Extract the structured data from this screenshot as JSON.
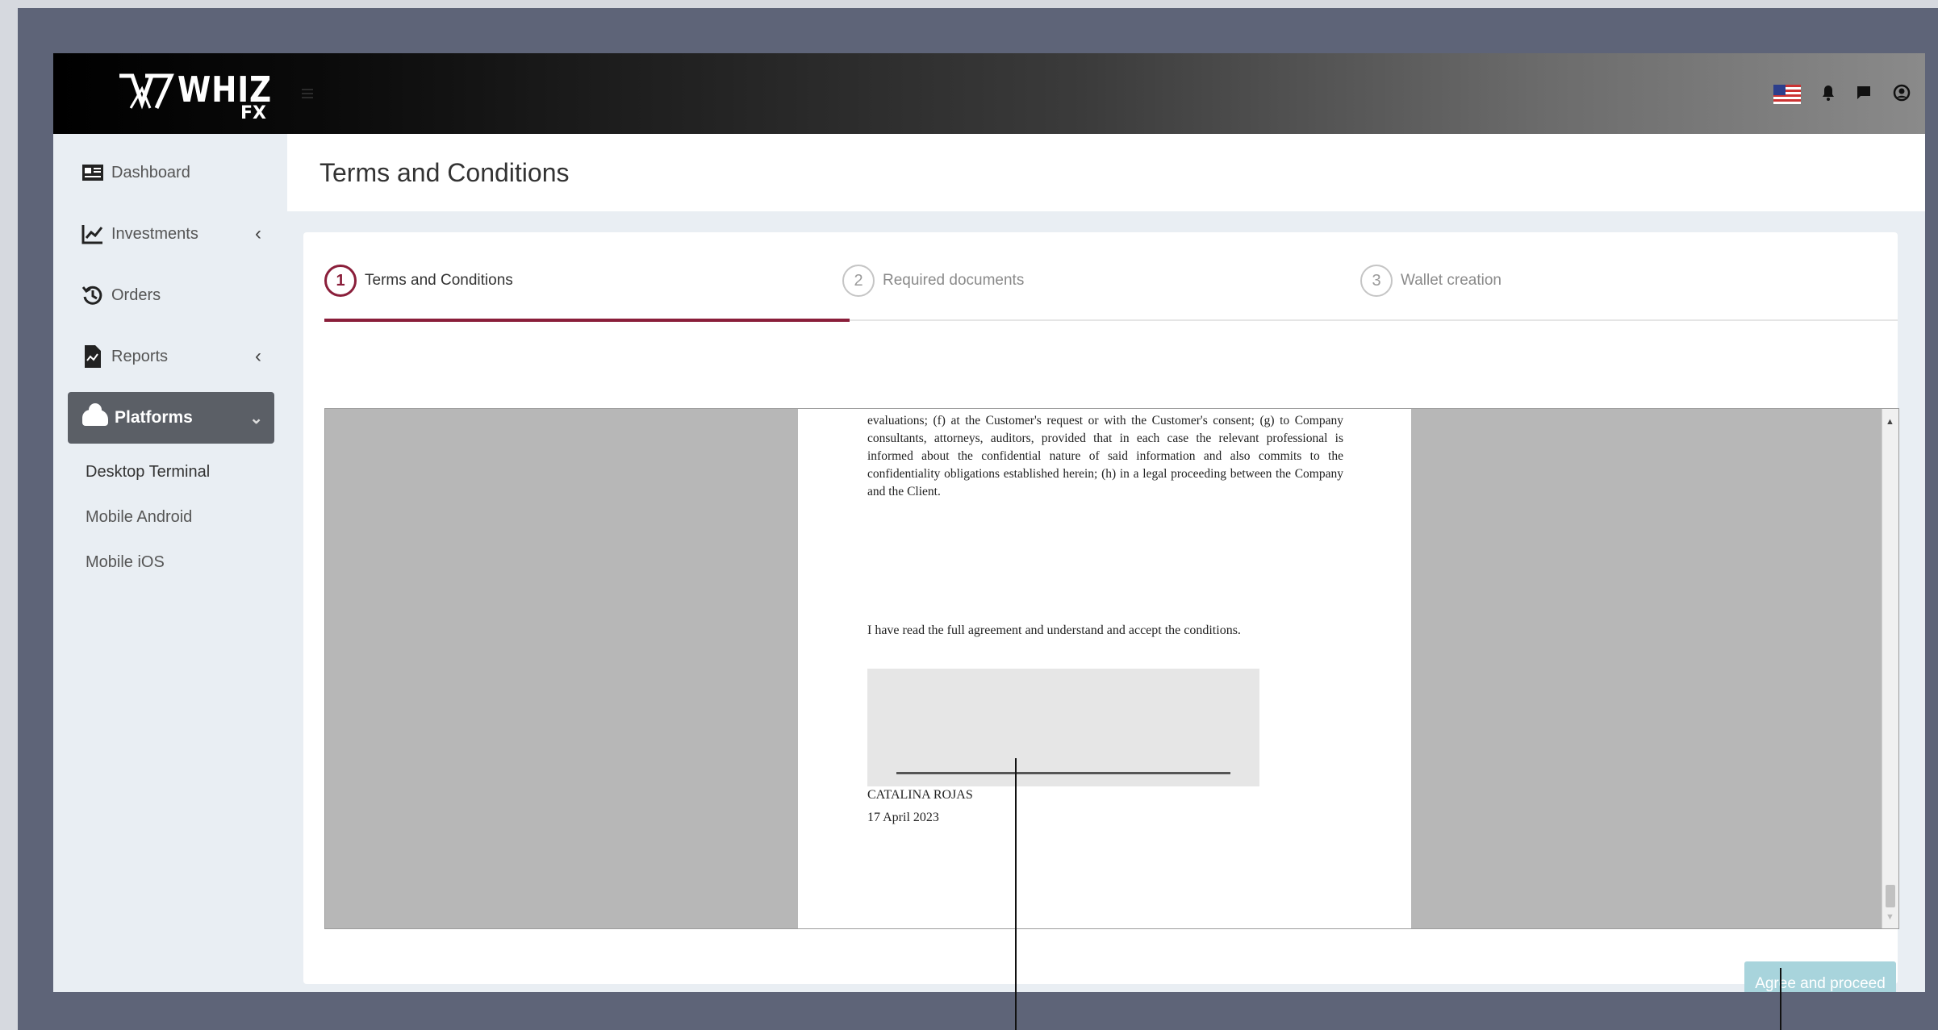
{
  "header": {
    "logo_text": "WHIZ",
    "logo_subtext": "FX",
    "icons": [
      "us-flag-icon",
      "bell-icon",
      "chat-icon",
      "user-icon"
    ]
  },
  "sidebar": {
    "items": [
      {
        "label": "Dashboard",
        "icon": "dashboard-icon"
      },
      {
        "label": "Investments",
        "icon": "chart-line-icon",
        "chevron": "‹"
      },
      {
        "label": "Orders",
        "icon": "history-icon"
      },
      {
        "label": "Reports",
        "icon": "file-chart-icon",
        "chevron": "‹"
      },
      {
        "label": "Platforms",
        "icon": "cloud-icon",
        "chevron": "⌄",
        "active": true
      }
    ],
    "sub_items": [
      "Desktop Terminal",
      "Mobile Android",
      "Mobile iOS"
    ]
  },
  "page": {
    "title": "Terms and Conditions"
  },
  "wizard": {
    "steps": [
      {
        "number": "1",
        "label": "Terms and Conditions",
        "active": true
      },
      {
        "number": "2",
        "label": "Required documents",
        "active": false
      },
      {
        "number": "3",
        "label": "Wallet creation",
        "active": false
      }
    ]
  },
  "document": {
    "paragraph": "evaluations; (f) at the Customer's request or with the Customer's consent; (g) to Company consultants, attorneys, auditors, provided that in each case the relevant professional is informed about the confidential nature of said information and also commits to the confidentiality obligations established herein; (h) in a legal proceeding between the Company and the Client.",
    "acceptance": "I have read the full agreement and understand and accept the conditions.",
    "signer_name": "CATALINA ROJAS",
    "signed_date": "17 April 2023"
  },
  "actions": {
    "proceed_label": "Agree and proceed"
  },
  "colors": {
    "accent": "#8a1e3a",
    "proceed_button": "#a8d4dc",
    "sidebar_active": "#5b5f66"
  }
}
